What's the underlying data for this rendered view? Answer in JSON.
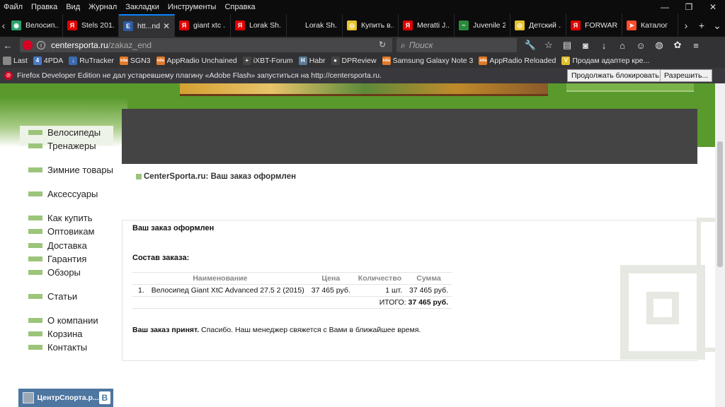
{
  "menubar": {
    "items": [
      "Файл",
      "Правка",
      "Вид",
      "Журнал",
      "Закладки",
      "Инструменты",
      "Справка"
    ]
  },
  "tabs": [
    {
      "label": "Велосип...",
      "icon": "green-shield-icon",
      "color": "#2aa16a",
      "glyph": "◉"
    },
    {
      "label": "Stels 201...",
      "icon": "yandex-icon",
      "color": "#e00000",
      "glyph": "Я"
    },
    {
      "label": "htt...nd",
      "icon": "centersporta-icon",
      "color": "#2d5aa0",
      "glyph": "E",
      "active": true
    },
    {
      "label": "giant xtc ...",
      "icon": "yandex-icon",
      "color": "#e00000",
      "glyph": "Я"
    },
    {
      "label": "Lorak Sh...",
      "icon": "yandex-icon",
      "color": "#e00000",
      "glyph": "Я"
    },
    {
      "label": "Lorak Sh...",
      "icon": "blank-icon",
      "color": "#0c0c0d",
      "glyph": ""
    },
    {
      "label": "Купить в...",
      "icon": "yellow-circle-icon",
      "color": "#e8c22a",
      "glyph": "◎"
    },
    {
      "label": "Meratti J...",
      "icon": "yandex-icon",
      "color": "#e00000",
      "glyph": "Я"
    },
    {
      "label": "Juvenile 24",
      "icon": "swoosh-icon",
      "color": "#2a8a3a",
      "glyph": "~"
    },
    {
      "label": "Детский ...",
      "icon": "yellow-circle-icon",
      "color": "#e8c22a",
      "glyph": "◎"
    },
    {
      "label": "FORWAR...",
      "icon": "yandex-icon",
      "color": "#e00000",
      "glyph": "Я"
    },
    {
      "label": "Каталог",
      "icon": "arrow-icon",
      "color": "#ff4d2a",
      "glyph": "➤"
    }
  ],
  "url": {
    "host": "centersporta.ru",
    "path": "/zakaz_end"
  },
  "search": {
    "placeholder": "Поиск"
  },
  "bookmarks": [
    {
      "label": "Last",
      "icon": "apple-icon",
      "color": "#888",
      "glyph": ""
    },
    {
      "label": "4PDA",
      "icon": "4pda-icon",
      "color": "#4a7ac8",
      "glyph": "4"
    },
    {
      "label": "RuTracker",
      "icon": "rutracker-icon",
      "color": "#3a6ab0",
      "glyph": "↓"
    },
    {
      "label": "SGN3",
      "icon": "folder-icon",
      "color": "#e07a2a",
      "glyph": "xda"
    },
    {
      "label": "AppRadio Unchained",
      "icon": "folder-icon",
      "color": "#e07a2a",
      "glyph": "xda"
    },
    {
      "label": "iXBT-Forum",
      "icon": "plus-icon",
      "color": "#444",
      "glyph": "+"
    },
    {
      "label": "Habr",
      "icon": "habr-icon",
      "color": "#5a7a9a",
      "glyph": "H"
    },
    {
      "label": "DPReview",
      "icon": "camera-icon",
      "color": "#444",
      "glyph": "●"
    },
    {
      "label": "Samsung Galaxy Note 3",
      "icon": "folder-icon",
      "color": "#e07a2a",
      "glyph": "xda"
    },
    {
      "label": "AppRadio Reloaded",
      "icon": "folder-icon",
      "color": "#e07a2a",
      "glyph": "xda"
    },
    {
      "label": "Продам адаптер кре...",
      "icon": "yellow-v-icon",
      "color": "#e0c02a",
      "glyph": "V"
    }
  ],
  "notification": {
    "text": "Firefox Developer Edition не дал устаревшему плагину «Adobe Flash» запуститься на http://centersporta.ru.",
    "continue_label": "Продолжать блокировать",
    "allow_label": "Разрешить..."
  },
  "sidebar": {
    "items": [
      "Велосипеды",
      "Тренажеры",
      "Зимние товары",
      "Аксессуары",
      "Как купить",
      "Оптовикам",
      "Доставка",
      "Гарантия",
      "Обзоры",
      "Статьи",
      "О компании",
      "Корзина",
      "Контакты"
    ]
  },
  "breadcrumb": "CenterSporta.ru: Ваш заказ оформлен",
  "order": {
    "title": "Ваш заказ оформлен",
    "composition_label": "Состав заказа:",
    "headers": {
      "name": "Наименование",
      "price": "Цена",
      "qty": "Количество",
      "sum": "Сумма"
    },
    "rows": [
      {
        "num": "1.",
        "name": "Велосипед Giant XtC Advanced 27.5 2 (2015)",
        "price": "37 465 руб.",
        "qty": "1 шт.",
        "sum": "37 465 руб."
      }
    ],
    "total_label": "ИТОГО:",
    "total_value": "37 465 руб.",
    "accepted_bold": "Ваш заказ принят.",
    "accepted_text": " Спасибо. Наш менеджер свяжется с Вами в ближайшее время."
  },
  "vk_widget": {
    "label": "ЦентрСпорта.р...",
    "badge": "B"
  },
  "colors": {
    "accent": "#0a84ff",
    "site_green": "#5a9a2c",
    "menu_square": "#9cc47a"
  }
}
